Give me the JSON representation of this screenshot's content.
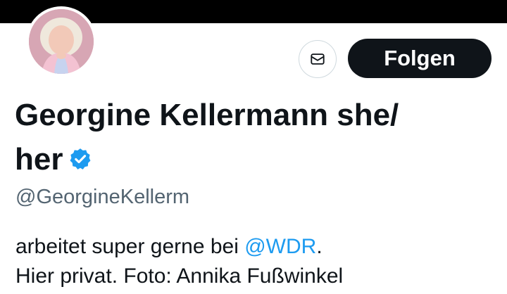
{
  "profile": {
    "display_name_line1": "Georgine Kellermann she/",
    "display_name_line2": "her",
    "handle": "@GeorgineKellerm",
    "bio_line1_prefix": "arbeitet super gerne bei ",
    "bio_mention": "@WDR",
    "bio_line1_suffix": ".",
    "bio_line2": "Hier privat. Foto: Annika Fußwinkel"
  },
  "actions": {
    "follow_label": "Folgen",
    "message_icon": "envelope-icon"
  },
  "colors": {
    "banner": "#000000",
    "follow_button_bg": "#0f1419",
    "verified_blue": "#1d9bf0",
    "link_blue": "#1d9bf0",
    "secondary_text": "#536471"
  },
  "icons": [
    "envelope-icon",
    "verified-badge-icon"
  ]
}
